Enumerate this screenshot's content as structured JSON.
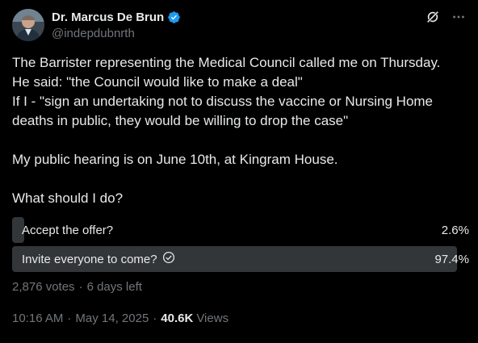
{
  "author": {
    "display_name": "Dr. Marcus De Brun",
    "handle": "@indepdubnrth",
    "verified_color": "#1d9bf0"
  },
  "header_icons": [
    "grok-icon",
    "more-icon"
  ],
  "tweet": {
    "lines": [
      "The Barrister representing the Medical Council called me on Thursday.",
      "He said: \"the Council would like to make a deal\"",
      "If I - \"sign an undertaking not to discuss the vaccine or Nursing Home deaths in public, they would be willing to drop the case\"",
      "My public hearing is on June 10th, at Kingram House.",
      "What should I do?"
    ]
  },
  "poll": {
    "options": [
      {
        "label": "Accept the offer?",
        "percent_text": "2.6%",
        "percent": 2.6,
        "selected": false
      },
      {
        "label": "Invite everyone to come?",
        "percent_text": "97.4%",
        "percent": 97.4,
        "selected": true
      }
    ],
    "votes": "2,876 votes",
    "time_left": "6 days left"
  },
  "meta": {
    "time": "10:16 AM",
    "date": "May 14, 2025",
    "views_count": "40.6K",
    "views_label": "Views"
  },
  "colors": {
    "background": "#000000",
    "text": "#e7e9ea",
    "muted": "#71767b",
    "poll_bar": "#333639",
    "accent": "#1d9bf0"
  }
}
